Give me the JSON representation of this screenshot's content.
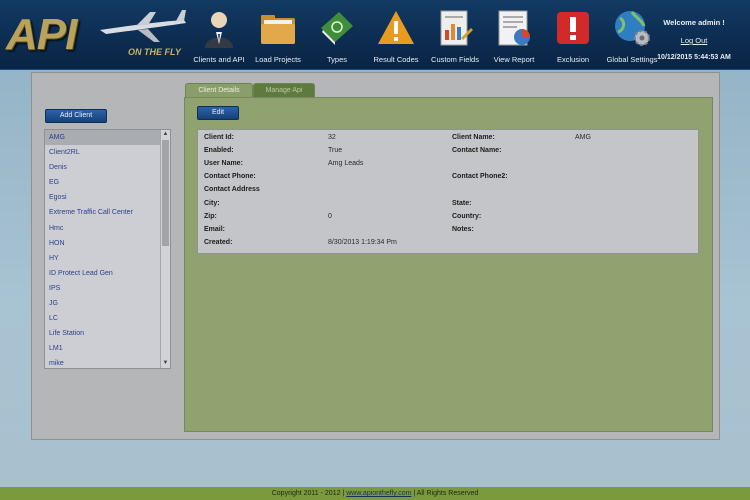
{
  "brand": {
    "logo_text": "API",
    "tagline": "ON THE FLY"
  },
  "nav": [
    {
      "label": "Clients and API",
      "icon": "user-icon"
    },
    {
      "label": "Load Projects",
      "icon": "folder-icon"
    },
    {
      "label": "Types",
      "icon": "book-icon"
    },
    {
      "label": "Result Codes",
      "icon": "warning-icon"
    },
    {
      "label": "Custom Fields",
      "icon": "document-chart-icon"
    },
    {
      "label": "View Report",
      "icon": "report-icon"
    },
    {
      "label": "Exclusion",
      "icon": "exclamation-icon"
    },
    {
      "label": "Global Settings",
      "icon": "globe-gear-icon"
    }
  ],
  "user": {
    "welcome": "Welcome admin !",
    "logout": "Log Out",
    "datetime": "10/12/2015 5:44:53 AM"
  },
  "sidebar": {
    "add_client": "Add Client",
    "clients": [
      "AMG",
      "Client2RL",
      "Denis",
      "EG",
      "Egosi",
      "Extreme Traffic Call Center",
      "Hmc",
      "HON",
      "HY",
      "ID Protect Lead Gen",
      "IPS",
      "JG",
      "LC",
      "Life Station",
      "LM1",
      "mike"
    ],
    "selected": "AMG"
  },
  "tabs": {
    "active": "Client Details",
    "inactive": "Manage Api"
  },
  "edit_label": "Edit",
  "details": {
    "client_id_label": "Client Id:",
    "client_id": "32",
    "client_name_label": "Client Name:",
    "client_name": "AMG",
    "enabled_label": "Enabled:",
    "enabled": "True",
    "contact_name_label": "Contact Name:",
    "user_name_label": "User Name:",
    "user_name": "Amg Leads",
    "contact_phone_label": "Contact Phone:",
    "contact_phone2_label": "Contact Phone2:",
    "contact_address_label": "Contact Address",
    "city_label": "City:",
    "state_label": "State:",
    "zip_label": "Zip:",
    "zip": "0",
    "country_label": "Country:",
    "email_label": "Email:",
    "notes_label": "Notes:",
    "created_label": "Created:",
    "created": "8/30/2013 1:19:34 Pm"
  },
  "footer": {
    "copyright": "Copyright 2011 - 2012  |",
    "link": "www.apionthefly.com",
    "rights": "|   All Rights Reserved"
  },
  "colors": {
    "header": "#0d2d52",
    "accent_green": "#8fa26f",
    "button_blue": "#1f4f8c"
  }
}
